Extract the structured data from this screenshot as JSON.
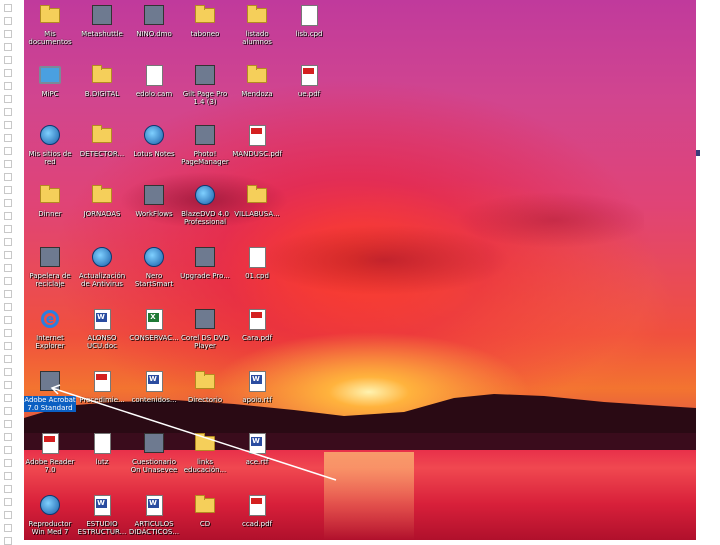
{
  "slide": {
    "bullet_color": "#3a3d7a"
  },
  "desktop_icons": [
    {
      "label": "Mis documentos",
      "icon": "my-documents-icon",
      "kind": "folder"
    },
    {
      "label": "Metashuttle",
      "icon": "app-icon",
      "kind": "generic"
    },
    {
      "label": "NINO.dmo",
      "icon": "shortcut-app-icon",
      "kind": "generic"
    },
    {
      "label": "taboneo",
      "icon": "folder-icon",
      "kind": "folder"
    },
    {
      "label": "listado alumnos",
      "icon": "folder-icon",
      "kind": "folder"
    },
    {
      "label": "lisb.cpd",
      "icon": "document-icon",
      "kind": "doc"
    },
    {
      "label": "MiPC",
      "icon": "my-computer-icon",
      "kind": "monitor"
    },
    {
      "label": "B.DIGITAL",
      "icon": "folder-icon",
      "kind": "folder"
    },
    {
      "label": "edolo.cam",
      "icon": "document-icon",
      "kind": "doc"
    },
    {
      "label": "Gilt Page Pro 1.4 (3)",
      "icon": "app-icon",
      "kind": "generic"
    },
    {
      "label": "Mendoza",
      "icon": "folder-icon",
      "kind": "folder"
    },
    {
      "label": "ue.pdf",
      "icon": "pdf-icon",
      "kind": "pdf"
    },
    {
      "label": "Mis sitios de red",
      "icon": "network-icon",
      "kind": "globe"
    },
    {
      "label": "DETECTOR...",
      "icon": "folder-icon",
      "kind": "folder"
    },
    {
      "label": "Lotus Notes",
      "icon": "app-icon",
      "kind": "globe"
    },
    {
      "label": "Photo! PageManager",
      "icon": "app-icon",
      "kind": "generic"
    },
    {
      "label": "MANDUSC.pdf",
      "icon": "pdf-icon",
      "kind": "pdf"
    },
    {
      "label": "Dinner",
      "icon": "folder-icon",
      "kind": "folder"
    },
    {
      "label": "JORNADAS",
      "icon": "folder-icon",
      "kind": "folder"
    },
    {
      "label": "WorkFlows",
      "icon": "app-icon",
      "kind": "generic"
    },
    {
      "label": "BlazeDVD 4.0 Professional",
      "icon": "app-icon",
      "kind": "globe"
    },
    {
      "label": "VILLABUSA...",
      "icon": "folder-icon",
      "kind": "folder"
    },
    {
      "label": "Papelera de reciclaje",
      "icon": "recycle-bin-icon",
      "kind": "generic"
    },
    {
      "label": "Actualización de Antivirus",
      "icon": "globe-icon",
      "kind": "globe"
    },
    {
      "label": "Nero StartSmart",
      "icon": "app-icon",
      "kind": "globe"
    },
    {
      "label": "Upgrade Pro...",
      "icon": "app-icon",
      "kind": "generic"
    },
    {
      "label": "01.cpd",
      "icon": "document-icon",
      "kind": "doc"
    },
    {
      "label": "Internet Explorer",
      "icon": "internet-explorer-icon",
      "kind": "ie"
    },
    {
      "label": "ALONSO UCU.doc",
      "icon": "word-document-icon",
      "kind": "word"
    },
    {
      "label": "CONSERVAC...",
      "icon": "excel-document-icon",
      "kind": "excel"
    },
    {
      "label": "Corel DS DVD Player",
      "icon": "app-icon",
      "kind": "generic"
    },
    {
      "label": "Cara.pdf",
      "icon": "pdf-icon",
      "kind": "pdf"
    },
    {
      "label": "Adobe Acrobat 7.0 Standard",
      "icon": "adobe-acrobat-icon",
      "kind": "generic"
    },
    {
      "label": "Procedimie...",
      "icon": "pdf-icon",
      "kind": "pdf"
    },
    {
      "label": "contenidos...",
      "icon": "word-document-icon",
      "kind": "word"
    },
    {
      "label": "Directorio",
      "icon": "folder-icon",
      "kind": "folder"
    },
    {
      "label": "apoio.rtf",
      "icon": "word-document-icon",
      "kind": "word"
    },
    {
      "label": "Adobe Reader 7.0",
      "icon": "adobe-reader-icon",
      "kind": "pdf"
    },
    {
      "label": "lutz",
      "icon": "document-icon",
      "kind": "doc"
    },
    {
      "label": "Cuestionario On Unasevee",
      "icon": "app-icon",
      "kind": "generic"
    },
    {
      "label": "links educación...",
      "icon": "folder-icon",
      "kind": "folder"
    },
    {
      "label": "ace.rtf",
      "icon": "word-document-icon",
      "kind": "word"
    },
    {
      "label": "Reproductor Win Med 7",
      "icon": "media-player-icon",
      "kind": "globe"
    },
    {
      "label": "ESTUDIO ESTRUCTUR...",
      "icon": "word-document-icon",
      "kind": "word"
    },
    {
      "label": "ARTÍCULOS DIDÁCTICOS...",
      "icon": "word-document-icon",
      "kind": "word"
    },
    {
      "label": "CD",
      "icon": "folder-icon",
      "kind": "folder"
    },
    {
      "label": "ccad.pdf",
      "icon": "pdf-icon",
      "kind": "pdf"
    }
  ]
}
